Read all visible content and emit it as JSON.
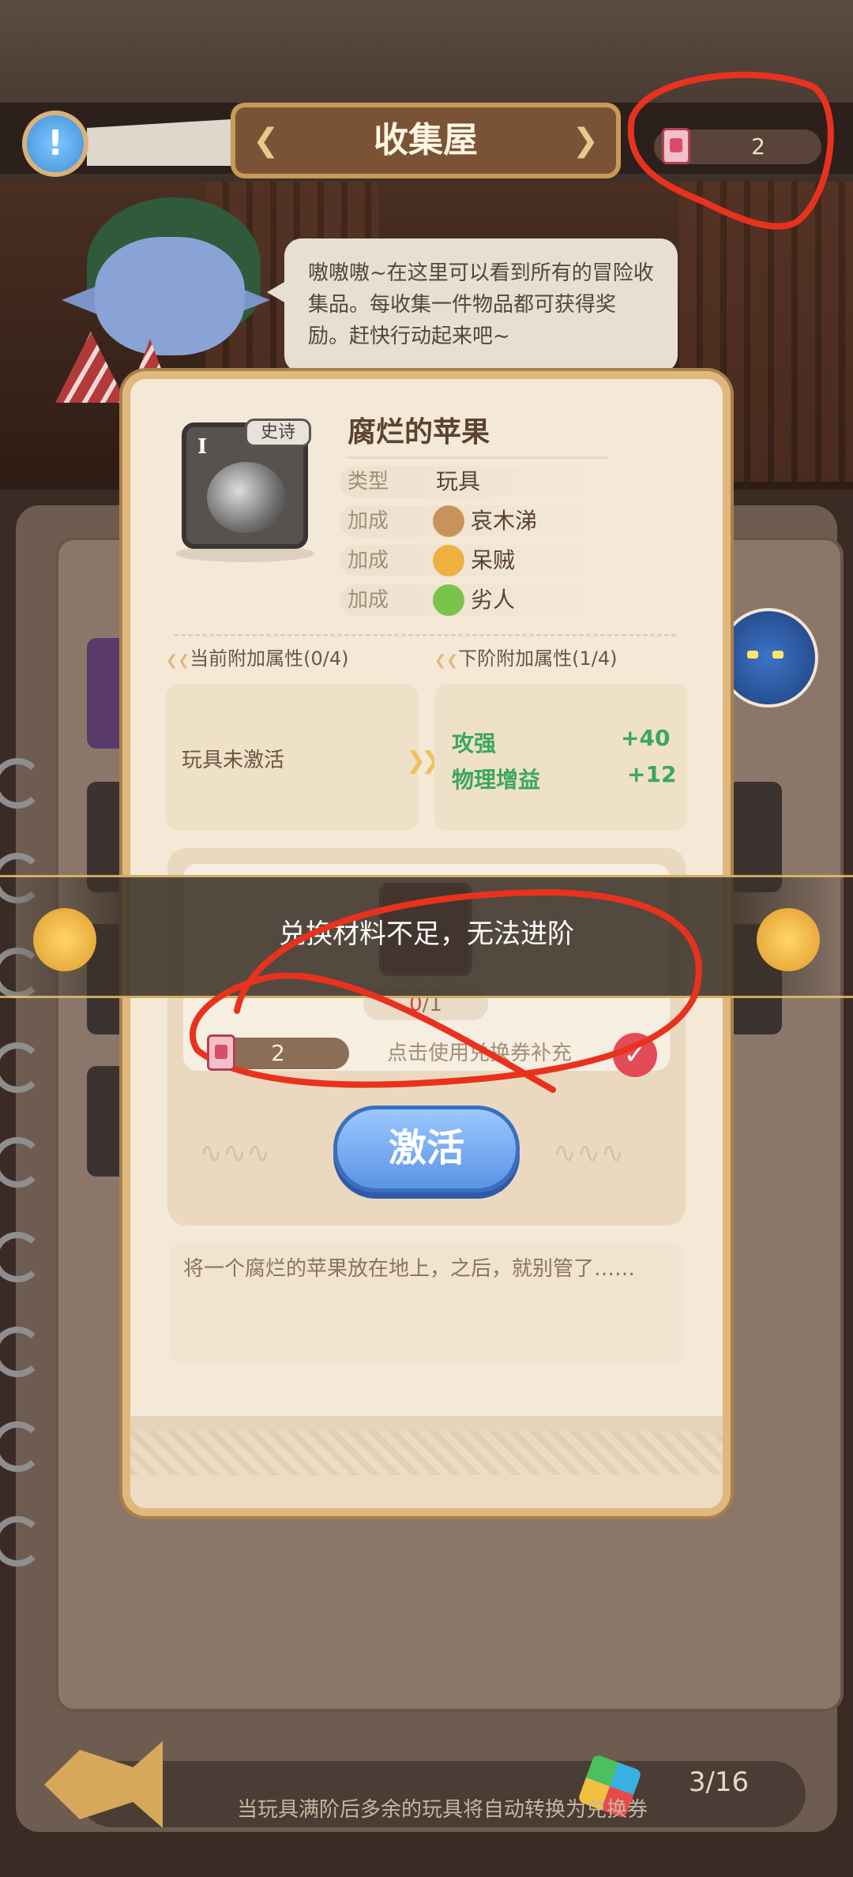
{
  "header": {
    "title": "收集屋",
    "currency_value": "2",
    "info_icon": "info-icon",
    "left_arrow_icon": "chevron-left-icon",
    "right_arrow_icon": "chevron-right-icon"
  },
  "npc": {
    "speech": "嗷嗷嗷~在这里可以看到所有的冒险收集品。每收集一件物品都可获得奖励。赶快行动起来吧~"
  },
  "popup": {
    "item": {
      "tier": "I",
      "rarity": "史诗",
      "name": "腐烂的苹果",
      "type_label": "类型",
      "type_value": "玩具",
      "bonuses": [
        {
          "label": "加成",
          "value": "哀木涕",
          "icon": "swords-icon",
          "color": "#c8935a"
        },
        {
          "label": "加成",
          "value": "呆贼",
          "icon": "daggers-icon",
          "color": "#f0b040"
        },
        {
          "label": "加成",
          "value": "劣人",
          "icon": "leaf-icon",
          "color": "#7ac34a"
        }
      ]
    },
    "current_attr_title": "当前附加属性(0/4)",
    "next_attr_title": "下阶附加属性(1/4)",
    "current_attr_text": "玩具未激活",
    "next_attrs": [
      {
        "name": "攻强",
        "value": "+40"
      },
      {
        "name": "物理增益",
        "value": "+12"
      }
    ],
    "material": {
      "have": "0",
      "need": "/1"
    },
    "owned_coupons": "2",
    "redeem_text": "点击使用兑换券补充",
    "activate_label": "激活",
    "description": "将一个腐烂的苹果放在地上，之后，就别管了……"
  },
  "toast": {
    "message": "兑换材料不足，无法进阶"
  },
  "footer": {
    "progress": "3/16",
    "note": "当玩具满阶后多余的玩具将自动转换为兑换券"
  },
  "colors": {
    "annotation": "#e8321e",
    "stat_green": "#3aa85c",
    "popup_bg": "#f4e9d6"
  }
}
